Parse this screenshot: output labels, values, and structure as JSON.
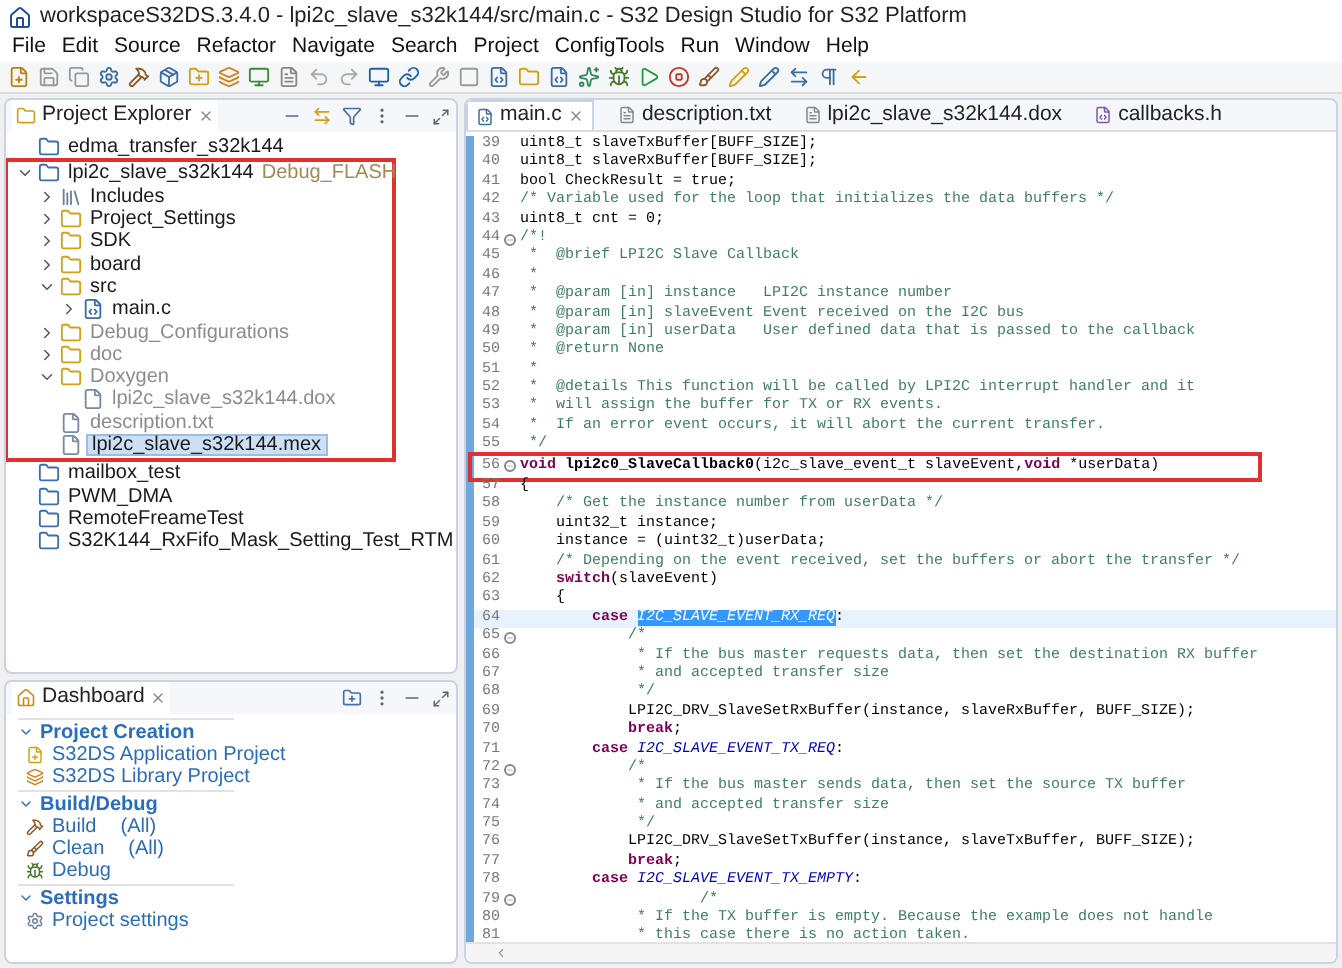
{
  "window": {
    "title": "workspaceS32DS.3.4.0 - lpi2c_slave_s32k144/src/main.c - S32 Design Studio for S32 Platform"
  },
  "menu": [
    "File",
    "Edit",
    "Source",
    "Refactor",
    "Navigate",
    "Search",
    "Project",
    "ConfigTools",
    "Run",
    "Window",
    "Help"
  ],
  "project_explorer": {
    "title": "Project Explorer",
    "tree": [
      {
        "label": "edma_transfer_s32k144",
        "kind": "project",
        "dimmed": false,
        "selected": false
      },
      {
        "label": "lpi2c_slave_s32k144",
        "config": "Debug_FLASH",
        "kind": "project",
        "expanded": true,
        "dimmed": false,
        "selected": false,
        "annotated": true,
        "children": [
          {
            "label": "Includes",
            "kind": "includes",
            "expanded": false,
            "dimmed": false,
            "selected": false
          },
          {
            "label": "Project_Settings",
            "kind": "folder",
            "expanded": false,
            "dimmed": false,
            "selected": false
          },
          {
            "label": "SDK",
            "kind": "folder",
            "expanded": false,
            "dimmed": false,
            "selected": false
          },
          {
            "label": "board",
            "kind": "folder",
            "expanded": false,
            "dimmed": false,
            "selected": false
          },
          {
            "label": "src",
            "kind": "folder",
            "expanded": true,
            "dimmed": false,
            "selected": false,
            "children": [
              {
                "label": "main.c",
                "kind": "cfile",
                "expanded": false,
                "dimmed": false,
                "selected": false
              }
            ]
          },
          {
            "label": "Debug_Configurations",
            "kind": "folder",
            "expanded": false,
            "dimmed": true,
            "selected": false
          },
          {
            "label": "doc",
            "kind": "folder",
            "expanded": false,
            "dimmed": true,
            "selected": false
          },
          {
            "label": "Doxygen",
            "kind": "folder",
            "expanded": true,
            "dimmed": true,
            "selected": false,
            "children": [
              {
                "label": "lpi2c_slave_s32k144.dox",
                "kind": "file",
                "dimmed": true,
                "selected": false
              }
            ]
          },
          {
            "label": "description.txt",
            "kind": "file",
            "dimmed": true,
            "selected": false
          },
          {
            "label": "lpi2c_slave_s32k144.mex",
            "kind": "file",
            "dimmed": false,
            "selected": true
          }
        ]
      },
      {
        "label": "mailbox_test",
        "kind": "project",
        "dimmed": false,
        "selected": false
      },
      {
        "label": "PWM_DMA",
        "kind": "project",
        "dimmed": false,
        "selected": false
      },
      {
        "label": "RemoteFreameTest",
        "kind": "project",
        "dimmed": false,
        "selected": false
      },
      {
        "label": "S32K144_RxFifo_Mask_Setting_Test_RTM",
        "kind": "project",
        "dimmed": false,
        "selected": false
      }
    ]
  },
  "dashboard": {
    "title": "Dashboard",
    "sections": [
      {
        "title": "Project Creation",
        "items": [
          {
            "label": "S32DS Application Project",
            "kind": "new-app"
          },
          {
            "label": "S32DS Library Project",
            "kind": "new-lib"
          }
        ]
      },
      {
        "title": "Build/Debug",
        "items": [
          {
            "label": "Build",
            "scope": "(All)",
            "kind": "build"
          },
          {
            "label": "Clean",
            "scope": "(All)",
            "kind": "clean"
          },
          {
            "label": "Debug",
            "kind": "debug"
          }
        ]
      },
      {
        "title": "Settings",
        "items": [
          {
            "label": "Project settings",
            "kind": "settings"
          }
        ]
      }
    ]
  },
  "editor": {
    "tabs": [
      {
        "label": "main.c",
        "kind": "c",
        "selected": true
      },
      {
        "label": "description.txt",
        "kind": "txt",
        "selected": false
      },
      {
        "label": "lpi2c_slave_s32k144.dox",
        "kind": "txt",
        "selected": false
      },
      {
        "label": "callbacks.h",
        "kind": "h",
        "selected": false
      }
    ],
    "lines": [
      {
        "number": "39",
        "segments": [
          {
            "text": "uint8_t slaveTxBuffer[BUFF_SIZE];",
            "kind": "plain"
          }
        ]
      },
      {
        "number": "40",
        "segments": [
          {
            "text": "uint8_t slaveRxBuffer[BUFF_SIZE];",
            "kind": "plain"
          }
        ]
      },
      {
        "number": "41",
        "segments": [
          {
            "text": "bool CheckResult = true;",
            "kind": "plain"
          }
        ]
      },
      {
        "number": "42",
        "segments": [
          {
            "text": "/* Variable used for the loop that initializes the data buffers */",
            "kind": "comment"
          }
        ]
      },
      {
        "number": "43",
        "segments": [
          {
            "text": "uint8_t cnt = 0;",
            "kind": "plain"
          }
        ]
      },
      {
        "number": "44",
        "fold": true,
        "segments": [
          {
            "text": "/*!",
            "kind": "comment"
          }
        ]
      },
      {
        "number": "45",
        "segments": [
          {
            "text": " *  @brief LPI2C Slave Callback",
            "kind": "comment"
          }
        ]
      },
      {
        "number": "46",
        "segments": [
          {
            "text": " *",
            "kind": "comment"
          }
        ]
      },
      {
        "number": "47",
        "segments": [
          {
            "text": " *  @param [in] instance   LPI2C instance number",
            "kind": "comment"
          }
        ]
      },
      {
        "number": "48",
        "segments": [
          {
            "text": " *  @param [in] slaveEvent Event received on the I2C bus",
            "kind": "comment"
          }
        ]
      },
      {
        "number": "49",
        "segments": [
          {
            "text": " *  @param [in] userData   User defined data that is passed to the callback",
            "kind": "comment"
          }
        ]
      },
      {
        "number": "50",
        "segments": [
          {
            "text": " *  @return None",
            "kind": "comment"
          }
        ]
      },
      {
        "number": "51",
        "segments": [
          {
            "text": " *",
            "kind": "comment"
          }
        ]
      },
      {
        "number": "52",
        "segments": [
          {
            "text": " *  @details This function will be called by LPI2C interrupt handler and it",
            "kind": "comment"
          }
        ]
      },
      {
        "number": "53",
        "segments": [
          {
            "text": " *  will assign the buffer for TX or RX events.",
            "kind": "comment"
          }
        ]
      },
      {
        "number": "54",
        "segments": [
          {
            "text": " *  If an error event occurs, it will abort the current transfer.",
            "kind": "comment"
          }
        ]
      },
      {
        "number": "55",
        "segments": [
          {
            "text": " */",
            "kind": "comment"
          }
        ]
      },
      {
        "number": "56",
        "fold": true,
        "annotated": true,
        "segments": [
          {
            "text": "void",
            "kind": "keyword"
          },
          {
            "text": " lpi2c0_SlaveCallback0",
            "kind": "bold"
          },
          {
            "text": "(i2c_slave_event_t slaveEvent,",
            "kind": "plain"
          },
          {
            "text": "void",
            "kind": "keyword"
          },
          {
            "text": " *userData)",
            "kind": "plain"
          }
        ]
      },
      {
        "number": "57",
        "segments": [
          {
            "text": "{",
            "kind": "plain"
          }
        ]
      },
      {
        "number": "58",
        "segments": [
          {
            "text": "    /* Get the instance number from userData */",
            "kind": "comment"
          }
        ]
      },
      {
        "number": "59",
        "segments": [
          {
            "text": "    uint32_t instance;",
            "kind": "plain"
          }
        ]
      },
      {
        "number": "60",
        "segments": [
          {
            "text": "    instance = (uint32_t)userData;",
            "kind": "plain"
          }
        ]
      },
      {
        "number": "61",
        "segments": [
          {
            "text": "    /* Depending on the event received, set the buffers or abort the transfer */",
            "kind": "comment"
          }
        ]
      },
      {
        "number": "62",
        "segments": [
          {
            "text": "    switch",
            "kind": "keyword"
          },
          {
            "text": "(slaveEvent)",
            "kind": "plain"
          }
        ]
      },
      {
        "number": "63",
        "segments": [
          {
            "text": "    {",
            "kind": "plain"
          }
        ]
      },
      {
        "number": "64",
        "current": true,
        "segments": [
          {
            "text": "        case ",
            "kind": "keyword"
          },
          {
            "text": "I2C_SLAVE_EVENT_RX_REQ",
            "kind": "selection"
          },
          {
            "text": ":",
            "kind": "plain"
          }
        ]
      },
      {
        "number": "65",
        "fold": true,
        "segments": [
          {
            "text": "            /*",
            "kind": "comment"
          }
        ]
      },
      {
        "number": "66",
        "segments": [
          {
            "text": "             * If the bus master requests data, then set the destination RX buffer",
            "kind": "comment"
          }
        ]
      },
      {
        "number": "67",
        "segments": [
          {
            "text": "             * and accepted transfer size",
            "kind": "comment"
          }
        ]
      },
      {
        "number": "68",
        "segments": [
          {
            "text": "             */",
            "kind": "comment"
          }
        ]
      },
      {
        "number": "69",
        "segments": [
          {
            "text": "            LPI2C_DRV_SlaveSetRxBuffer(instance, slaveRxBuffer, BUFF_SIZE);",
            "kind": "plain"
          }
        ]
      },
      {
        "number": "70",
        "segments": [
          {
            "text": "            break",
            "kind": "keyword"
          },
          {
            "text": ";",
            "kind": "plain"
          }
        ]
      },
      {
        "number": "71",
        "segments": [
          {
            "text": "        case ",
            "kind": "keyword"
          },
          {
            "text": "I2C_SLAVE_EVENT_TX_REQ",
            "kind": "constant"
          },
          {
            "text": ":",
            "kind": "plain"
          }
        ]
      },
      {
        "number": "72",
        "fold": true,
        "segments": [
          {
            "text": "            /*",
            "kind": "comment"
          }
        ]
      },
      {
        "number": "73",
        "segments": [
          {
            "text": "             * If the bus master sends data, then set the source TX buffer",
            "kind": "comment"
          }
        ]
      },
      {
        "number": "74",
        "segments": [
          {
            "text": "             * and accepted transfer size",
            "kind": "comment"
          }
        ]
      },
      {
        "number": "75",
        "segments": [
          {
            "text": "             */",
            "kind": "comment"
          }
        ]
      },
      {
        "number": "76",
        "segments": [
          {
            "text": "            LPI2C_DRV_SlaveSetTxBuffer(instance, slaveTxBuffer, BUFF_SIZE);",
            "kind": "plain"
          }
        ]
      },
      {
        "number": "77",
        "segments": [
          {
            "text": "            break",
            "kind": "keyword"
          },
          {
            "text": ";",
            "kind": "plain"
          }
        ]
      },
      {
        "number": "78",
        "segments": [
          {
            "text": "        case ",
            "kind": "keyword"
          },
          {
            "text": "I2C_SLAVE_EVENT_TX_EMPTY",
            "kind": "constant"
          },
          {
            "text": ":",
            "kind": "plain"
          }
        ]
      },
      {
        "number": "79",
        "fold": true,
        "segments": [
          {
            "text": "                    /*",
            "kind": "comment"
          }
        ]
      },
      {
        "number": "80",
        "segments": [
          {
            "text": "             * If the TX buffer is empty. Because the example does not handle",
            "kind": "comment"
          }
        ]
      },
      {
        "number": "81",
        "segments": [
          {
            "text": "             * this case there is no action taken.",
            "kind": "comment"
          }
        ]
      }
    ]
  }
}
